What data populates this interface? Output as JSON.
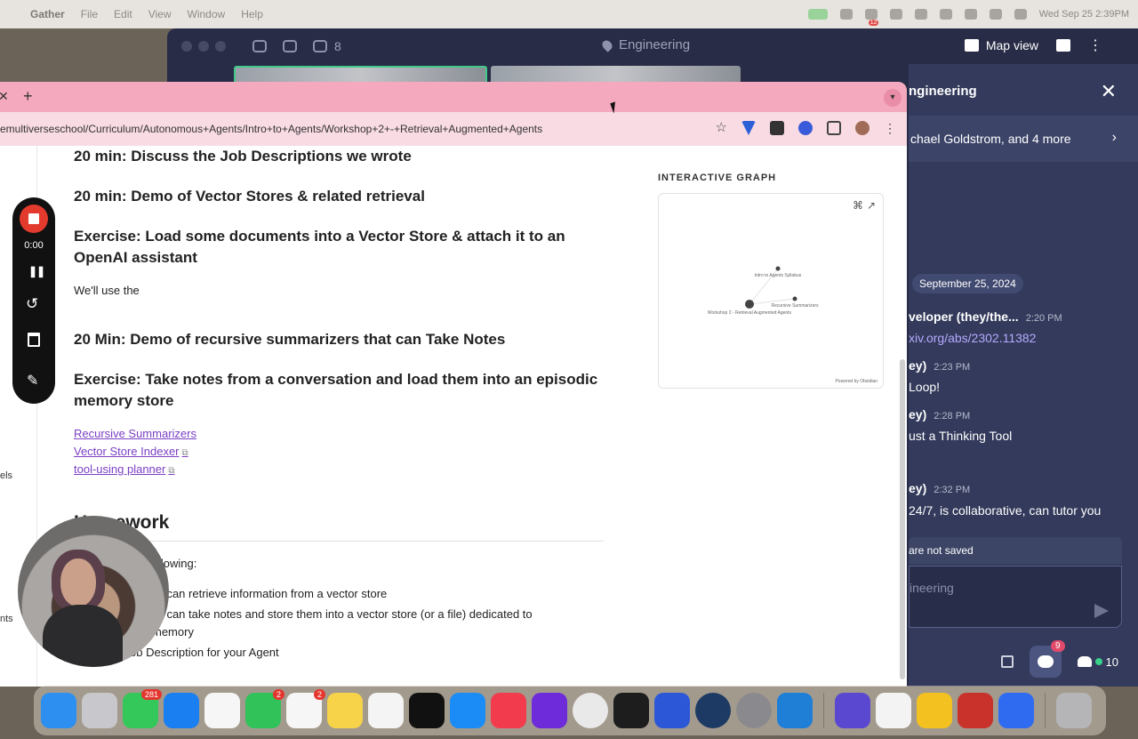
{
  "menubar": {
    "app_name": "Gather",
    "menus": [
      "File",
      "Edit",
      "View",
      "Window",
      "Help"
    ],
    "notification_badge": "12",
    "clock": "Wed Sep 25  2:39PM"
  },
  "gather": {
    "participant_count": "8",
    "room_title": "Engineering",
    "map_view_label": "Map view",
    "chat": {
      "title": "ngineering",
      "members": "chael Goldstrom, and 4 more",
      "date": "September 25, 2024",
      "messages": [
        {
          "who": "veloper (they/the...",
          "time": "2:20 PM"
        },
        {
          "text": "xiv.org/abs/2302.11382",
          "link": true
        },
        {
          "who": "ey)",
          "time": "2:23 PM"
        },
        {
          "text": "Loop!"
        },
        {
          "who": "ey)",
          "time": "2:28 PM"
        },
        {
          "text": "ust a Thinking Tool"
        },
        {
          "who": "ey)",
          "time": "2:32 PM"
        },
        {
          "text": "24/7, is collaborative, can tutor you"
        }
      ],
      "unsaved_notice": "are not saved",
      "input_placeholder": "ineering",
      "chat_badge": "9",
      "people_count": "10"
    }
  },
  "browser": {
    "url": "emultiverseschool/Curriculum/Autonomous+Agents/Intro+to+Agents/Workshop+2+-+Retrieval+Augmented+Agents",
    "left_strip": [
      "els",
      "nts",
      "dels"
    ],
    "article": {
      "headings": [
        "20 min: Discuss the Job Descriptions we wrote",
        "20 min: Demo of Vector Stores & related retrieval",
        "Exercise: Load some documents into a Vector Store & attach it to an OpenAI assistant",
        "20 Min: Demo of recursive summarizers that can Take Notes",
        "Exercise: Take notes from a conversation and load them into an episodic memory store"
      ],
      "paragraph": "We'll use the",
      "links": [
        "Recursive Summarizers",
        "Vector Store Indexer",
        "tool-using planner"
      ],
      "homework_heading": "Homework",
      "homework_intro": "llowing:",
      "homework_items": [
        "at can retrieve information from a vector store",
        "at can take notes and store them into a vector store (or a file) dedicated to",
        "memory",
        "ob Description for your Agent"
      ]
    },
    "graph": {
      "title": "INTERACTIVE GRAPH",
      "nodes": [
        "Intro to Agents Syllabus",
        "Recursive Summarizers",
        "Workshop 2 - Retrieval Augmented Agents"
      ],
      "powered_by": "Powered by Obsidian"
    }
  },
  "recorder": {
    "timer": "0:00"
  },
  "dock": {
    "badges": {
      "messages": "281",
      "facetime": "2",
      "reminders": "2"
    }
  },
  "colors": {
    "tab_bar": "#f4a9bf",
    "gather_bg": "#282c46",
    "chat_bg": "#333a5b",
    "link": "#7b3fc4",
    "record": "#e23b2e"
  }
}
